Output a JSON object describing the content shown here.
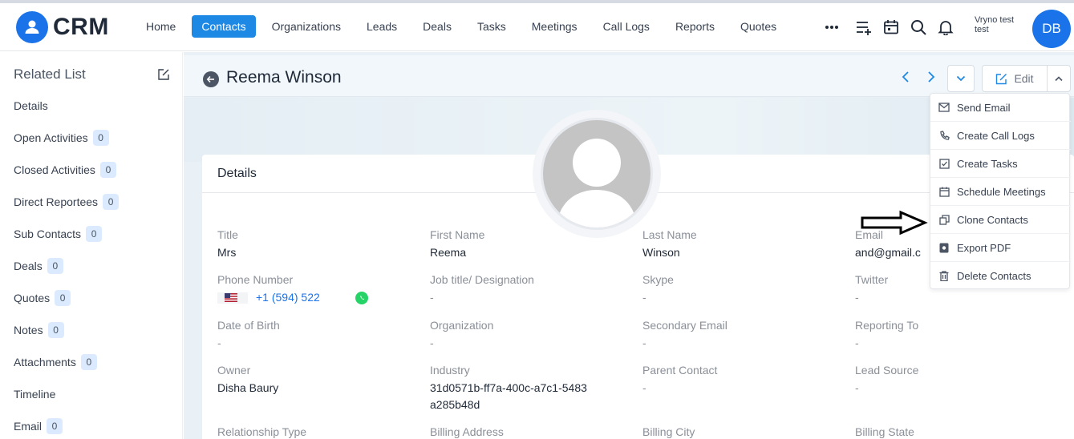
{
  "app": {
    "logo_text": "CRM"
  },
  "nav": {
    "items": [
      {
        "label": "Home"
      },
      {
        "label": "Contacts"
      },
      {
        "label": "Organizations"
      },
      {
        "label": "Leads"
      },
      {
        "label": "Deals"
      },
      {
        "label": "Tasks"
      },
      {
        "label": "Meetings"
      },
      {
        "label": "Call Logs"
      },
      {
        "label": "Reports"
      },
      {
        "label": "Quotes"
      }
    ],
    "active": "Contacts",
    "icons": [
      "more-icon",
      "add-list-icon",
      "calendar-icon",
      "search-icon",
      "bell-icon"
    ]
  },
  "user": {
    "name_line1": "Vryno test",
    "name_line2": "test",
    "initials": "DB"
  },
  "sidebar": {
    "title": "Related List",
    "items": [
      {
        "label": "Details",
        "count": null
      },
      {
        "label": "Open Activities",
        "count": "0"
      },
      {
        "label": "Closed Activities",
        "count": "0"
      },
      {
        "label": "Direct Reportees",
        "count": "0"
      },
      {
        "label": "Sub Contacts",
        "count": "0"
      },
      {
        "label": "Deals",
        "count": "0"
      },
      {
        "label": "Quotes",
        "count": "0"
      },
      {
        "label": "Notes",
        "count": "0"
      },
      {
        "label": "Attachments",
        "count": "0"
      },
      {
        "label": "Timeline",
        "count": null
      },
      {
        "label": "Email",
        "count": "0"
      }
    ]
  },
  "record": {
    "title": "Reema Winson",
    "edit_label": "Edit"
  },
  "details": {
    "section_title": "Details",
    "fields": [
      {
        "label": "Title",
        "value": "Mrs"
      },
      {
        "label": "First Name",
        "value": "Reema"
      },
      {
        "label": "Last Name",
        "value": "Winson"
      },
      {
        "label": "Email",
        "value": "and@gmail.c"
      },
      {
        "label": "Phone Number",
        "value": "+1 (594) 522"
      },
      {
        "label": "Job title/ Designation",
        "value": "-"
      },
      {
        "label": "Skype",
        "value": "-"
      },
      {
        "label": "Twitter",
        "value": "-"
      },
      {
        "label": "Date of Birth",
        "value": "-"
      },
      {
        "label": "Organization",
        "value": "-"
      },
      {
        "label": "Secondary Email",
        "value": "-"
      },
      {
        "label": "Reporting To",
        "value": "-"
      },
      {
        "label": "Owner",
        "value": "Disha Baury"
      },
      {
        "label": "Industry",
        "value": "31d0571b-ff7a-400c-a7c1-5483a285b48d"
      },
      {
        "label": "Parent Contact",
        "value": "-"
      },
      {
        "label": "Lead Source",
        "value": "-"
      },
      {
        "label": "Relationship Type",
        "value": ""
      },
      {
        "label": "Billing Address",
        "value": ""
      },
      {
        "label": "Billing City",
        "value": ""
      },
      {
        "label": "Billing State",
        "value": ""
      }
    ]
  },
  "menu": {
    "items": [
      {
        "label": "Send Email",
        "icon": "mail-icon"
      },
      {
        "label": "Create Call Logs",
        "icon": "phone-icon"
      },
      {
        "label": "Create Tasks",
        "icon": "checkbox-icon"
      },
      {
        "label": "Schedule Meetings",
        "icon": "calendar-icon"
      },
      {
        "label": "Clone Contacts",
        "icon": "copy-icon"
      },
      {
        "label": "Export PDF",
        "icon": "pdf-icon"
      },
      {
        "label": "Delete Contacts",
        "icon": "trash-icon"
      }
    ]
  },
  "colors": {
    "accent": "#1e88e5",
    "badge_bg": "#dbeafe",
    "whatsapp": "#25d366"
  }
}
